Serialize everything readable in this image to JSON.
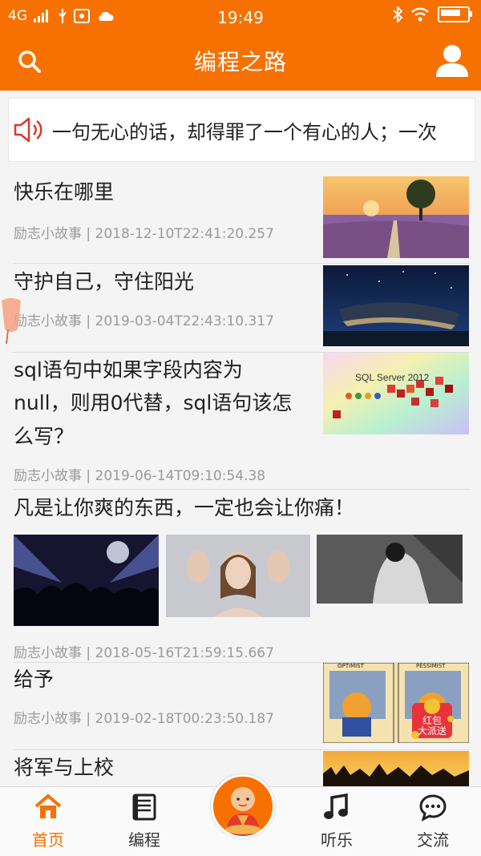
{
  "status_bar": {
    "network": "4G",
    "time": "19:49"
  },
  "header": {
    "title": "编程之路"
  },
  "notice": {
    "text": "一句无心的话，却得罪了一个有心的人；一次"
  },
  "articles": [
    {
      "title": "快乐在哪里",
      "category": "励志小故事",
      "timestamp": "2018-12-10T22:41:20.257",
      "image": "sunset-tree"
    },
    {
      "title": "守护自己，守住阳光",
      "category": "励志小故事",
      "timestamp": "2019-03-04T22:43:10.317",
      "image": "night-building"
    },
    {
      "title_lines": [
        "sql语句中如果字段内容为",
        "null，则用0代替，sql语句该怎",
        "么写？"
      ],
      "category": "励志小故事",
      "timestamp": "2019-06-14T09:10:54.38",
      "image": "sql-server-2012",
      "image_text": "SQL Server 2012"
    },
    {
      "title": "凡是让你爽的东西，一定也会让你痛！",
      "category": "励志小故事",
      "timestamp": "2018-05-16T21:59:15.667",
      "images": [
        "concert-crowd",
        "woman-hands",
        "sad-person"
      ]
    },
    {
      "title": "给予",
      "category": "励志小故事",
      "timestamp": "2019-02-18T00:23:50.187",
      "image": "optimist-pessimist-comic",
      "image_text": [
        "OPTIMIST",
        "PESSIMIST"
      ],
      "badge": "红包大派送",
      "badge_lines": [
        "红包",
        "大派送"
      ]
    },
    {
      "title": "将军与上校",
      "image": "crowd-sunset"
    }
  ],
  "separator": " | ",
  "tabs": [
    {
      "label": "首页",
      "icon": "home-icon",
      "active": true
    },
    {
      "label": "编程",
      "icon": "book-icon",
      "active": false
    },
    {
      "label": "",
      "icon": "monk-avatar",
      "active": false
    },
    {
      "label": "听乐",
      "icon": "music-icon",
      "active": false
    },
    {
      "label": "交流",
      "icon": "chat-icon",
      "active": false
    }
  ],
  "colors": {
    "brand": "#f77100",
    "meta_text": "#9a9a9a",
    "tab_active": "#f77100",
    "background": "#f4f4f4"
  }
}
